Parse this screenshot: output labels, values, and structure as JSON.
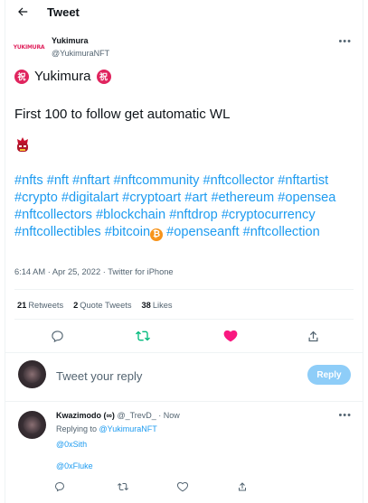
{
  "header": {
    "title": "Tweet",
    "back_icon": "arrow-left-icon"
  },
  "author": {
    "logo_text": "YUKIMURA",
    "name": "Yukimura",
    "handle": "@YukimuraNFT",
    "more_icon": "ellipsis-icon"
  },
  "tweet": {
    "display_emoji": "祝",
    "display_name": "Yukimura",
    "text": "First 100 to follow get automatic WL",
    "emoji_icon": "samurai-mask-emoji-icon",
    "hashtags": [
      "#nfts",
      "#nft",
      "#nftart",
      "#nftcommunity",
      "#nftcollector",
      "#nftartist",
      "#crypto",
      "#digitalart",
      "#cryptoart",
      "#art",
      "#ethereum",
      "#opensea",
      "#nftcollectors",
      "#blockchain",
      "#nftdrop",
      "#cryptocurrency",
      "#nftcollectibles",
      "#bitcoin",
      "#openseanft",
      "#nftcollection"
    ],
    "bitcoin_glyph": "₿",
    "time": "6:14 AM",
    "date": "Apr 25, 2022",
    "source": "Twitter for iPhone"
  },
  "stats": {
    "retweets_count": "21",
    "retweets_label": "Retweets",
    "quotes_count": "2",
    "quotes_label": "Quote Tweets",
    "likes_count": "38",
    "likes_label": "Likes"
  },
  "actions": [
    "reply-icon",
    "retweet-icon",
    "like-icon",
    "share-icon"
  ],
  "colors": {
    "accent": "#1d9bf0",
    "retweet": "#00ba7c",
    "like": "#f91880",
    "muted": "#536471"
  },
  "composer": {
    "placeholder": "Tweet your reply",
    "button": "Reply"
  },
  "reply": {
    "name": "Kwazimodo (∞)",
    "handle": "@_TrevD_",
    "separator": "·",
    "time": "Now",
    "replying_prefix": "Replying to",
    "replying_to": "@YukimuraNFT",
    "mention1": "@0xSith",
    "mention2": "@0xFluke"
  }
}
